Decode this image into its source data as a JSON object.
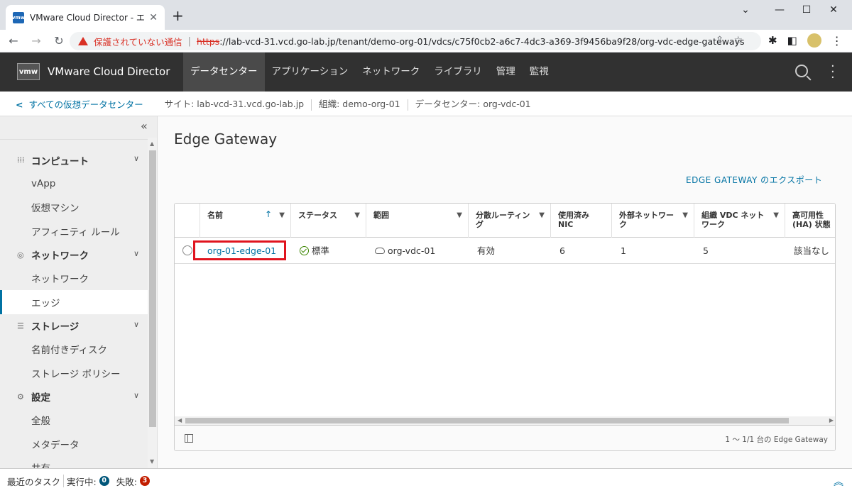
{
  "browser": {
    "tab_title": "VMware Cloud Director - エッジ",
    "favicon": "vmw",
    "security_warning": "保護されていない通信",
    "url_protocol": "https",
    "url_rest": "://lab-vcd-31.vcd.go-lab.jp/tenant/demo-org-01/vdcs/c75f0cb2-a6c7-4dc3-a369-3f9456ba9f28/org-vdc-edge-gateways"
  },
  "app": {
    "logo": "vmw",
    "title": "VMware Cloud Director",
    "nav": [
      "データセンター",
      "アプリケーション",
      "ネットワーク",
      "ライブラリ",
      "管理",
      "監視"
    ],
    "active_nav": "データセンター"
  },
  "breadcrumb": {
    "back_label": "すべての仮想データセンター",
    "site": "サイト: lab-vcd-31.vcd.go-lab.jp",
    "org": "組織: demo-org-01",
    "datacenter": "データセンター: org-vdc-01"
  },
  "sidebar": {
    "groups": [
      {
        "label": "コンピュート",
        "icon": "grid-icon",
        "items": [
          "vApp",
          "仮想マシン",
          "アフィニティ ルール"
        ]
      },
      {
        "label": "ネットワーク",
        "icon": "network-icon",
        "items": [
          "ネットワーク",
          "エッジ"
        ]
      },
      {
        "label": "ストレージ",
        "icon": "storage-icon",
        "items": [
          "名前付きディスク",
          "ストレージ ポリシー"
        ]
      },
      {
        "label": "設定",
        "icon": "gear-icon",
        "items": [
          "全般",
          "メタデータ",
          "共有"
        ]
      }
    ],
    "active_item": "エッジ"
  },
  "main": {
    "title": "Edge Gateway",
    "export_label": "EDGE GATEWAY のエクスポート",
    "columns": [
      {
        "label": "名前",
        "sorted": "asc"
      },
      {
        "label": "ステータス"
      },
      {
        "label": "範囲"
      },
      {
        "label": "分散ルーティング"
      },
      {
        "label": "使用済み NIC"
      },
      {
        "label": "外部ネットワーク"
      },
      {
        "label": "組織 VDC ネットワーク"
      },
      {
        "label": "高可用性 (HA) 状態"
      }
    ],
    "rows": [
      {
        "name": "org-01-edge-01",
        "status": "標準",
        "scope": "org-vdc-01",
        "distributed_routing": "有効",
        "used_nics": "6",
        "external_networks": "1",
        "org_vdc_networks": "5",
        "ha_state": "該当なし"
      }
    ],
    "footer_count": "1 ～ 1/1 台の Edge Gateway"
  },
  "taskbar": {
    "recent_tasks": "最近のタスク",
    "running_label": "実行中:",
    "running_count": "0",
    "failed_label": "失敗:",
    "failed_count": "3"
  },
  "colors": {
    "accent": "#0072a3",
    "header_bg": "#313131",
    "highlight": "#e0141e",
    "status_ok": "#3c8500"
  }
}
